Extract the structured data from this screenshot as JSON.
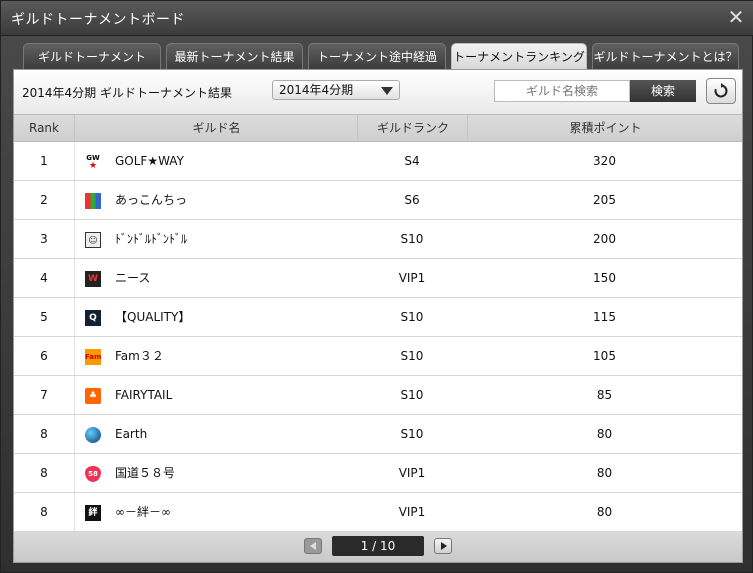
{
  "window": {
    "title": "ギルドトーナメントボード"
  },
  "tabs": [
    {
      "label": "ギルドトーナメント"
    },
    {
      "label": "最新トーナメント結果"
    },
    {
      "label": "トーナメント途中経過"
    },
    {
      "label": "トーナメントランキング"
    },
    {
      "label": "ギルドトーナメントとは？"
    }
  ],
  "active_tab": "トーナメントランキング",
  "filter": {
    "period_label": "2014年4分期 ギルドトーナメント結果",
    "period_select": "2014年4分期",
    "search_placeholder": "ギルド名検索",
    "search_button": "検索"
  },
  "table": {
    "headers": {
      "rank": "Rank",
      "name": "ギルド名",
      "guild_rank": "ギルドランク",
      "points": "累積ポイント"
    },
    "rows": [
      {
        "rank": "1",
        "name": "GOLF★WAY",
        "guild_rank": "S4",
        "points": "320",
        "icon": "gw-star-emblem"
      },
      {
        "rank": "2",
        "name": "あっこんちっ",
        "guild_rank": "S6",
        "points": "205",
        "icon": "pixel-emblem"
      },
      {
        "rank": "3",
        "name": "ﾄﾞﾝﾄﾞﾙﾄﾞﾝﾄﾞﾙ",
        "guild_rank": "S10",
        "points": "200",
        "icon": "face-emblem"
      },
      {
        "rank": "4",
        "name": "ニース",
        "guild_rank": "VIP1",
        "points": "150",
        "icon": "shield-emblem"
      },
      {
        "rank": "5",
        "name": "【QUALITY】",
        "guild_rank": "S10",
        "points": "115",
        "icon": "q-emblem"
      },
      {
        "rank": "6",
        "name": "Fam３２",
        "guild_rank": "S10",
        "points": "105",
        "icon": "fam-emblem"
      },
      {
        "rank": "7",
        "name": "FAIRYTAIL",
        "guild_rank": "S10",
        "points": "85",
        "icon": "fairy-emblem"
      },
      {
        "rank": "8",
        "name": "Earth",
        "guild_rank": "S10",
        "points": "80",
        "icon": "globe-emblem"
      },
      {
        "rank": "8",
        "name": "国道５８号",
        "guild_rank": "VIP1",
        "points": "80",
        "icon": "route-58-emblem"
      },
      {
        "rank": "8",
        "name": "∞－絆－∞",
        "guild_rank": "VIP1",
        "points": "80",
        "icon": "kizuna-emblem"
      }
    ]
  },
  "pager": {
    "label": "1 / 10"
  },
  "colors": {
    "accent": "#333333",
    "panel": "#e6e6e6",
    "active_tab": "#f2f2f2"
  }
}
